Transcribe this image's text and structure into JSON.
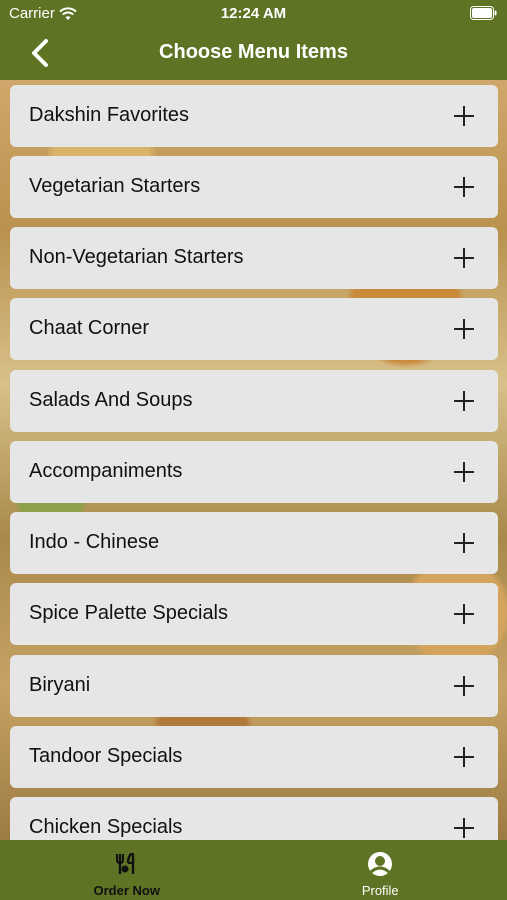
{
  "status_bar": {
    "carrier": "Carrier",
    "time": "12:24 AM"
  },
  "nav": {
    "title": "Choose Menu Items",
    "back_icon": "chevron-left-icon"
  },
  "menu": {
    "items": [
      {
        "label": "Dakshin Favorites"
      },
      {
        "label": "Vegetarian Starters"
      },
      {
        "label": "Non-Vegetarian Starters"
      },
      {
        "label": "Chaat Corner"
      },
      {
        "label": "Salads And Soups"
      },
      {
        "label": "Accompaniments"
      },
      {
        "label": "Indo - Chinese"
      },
      {
        "label": "Spice Palette Specials"
      },
      {
        "label": "Biryani"
      },
      {
        "label": "Tandoor Specials"
      },
      {
        "label": "Chicken Specials"
      }
    ]
  },
  "tabs": [
    {
      "label": "Order Now",
      "icon": "fork-knife-icon",
      "active": true
    },
    {
      "label": "Profile",
      "icon": "person-icon",
      "active": false
    }
  ],
  "colors": {
    "bar_green": "#5e7324",
    "card_bg": "#e6e6e6"
  }
}
